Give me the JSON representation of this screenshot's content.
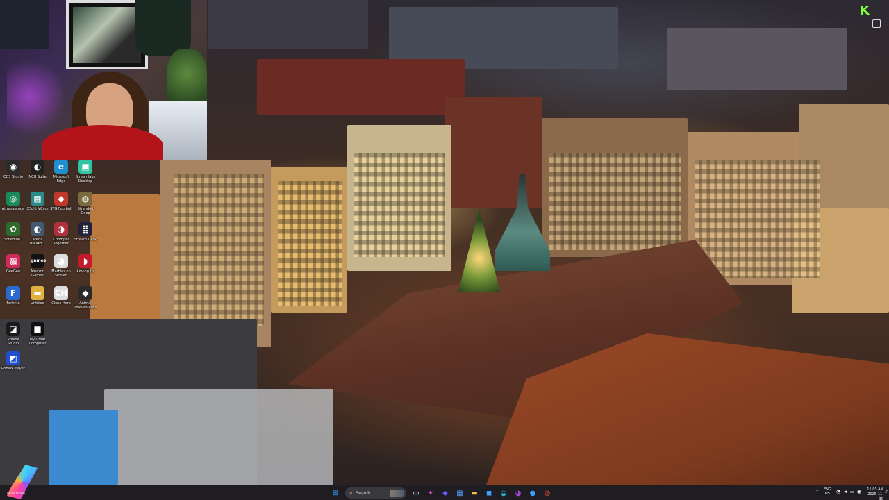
{
  "desktop": {
    "icons": [
      {
        "id": "obs",
        "label": "OBS Studio",
        "color": "#2b2b2b",
        "glyph": "◉"
      },
      {
        "id": "nch",
        "label": "NCH Suite",
        "color": "#222222",
        "glyph": "◐"
      },
      {
        "id": "edge",
        "label": "Microsoft Edge",
        "color": "#1f8fd0",
        "glyph": "e"
      },
      {
        "id": "streamlabs",
        "label": "Streamlabs Desktop",
        "color": "#31c3a2",
        "glyph": "▣"
      },
      {
        "id": "athenascope",
        "label": "Athenascope",
        "color": "#1a8a5a",
        "glyph": "◎"
      },
      {
        "id": "xsplit",
        "label": "XSplit VCam",
        "color": "#2a8a8a",
        "glyph": "▦"
      },
      {
        "id": "stgfootball",
        "label": "STG Football",
        "color": "#c0392b",
        "glyph": "◆"
      },
      {
        "id": "stranded",
        "label": "Stranded Deep",
        "color": "#7a6a40",
        "glyph": "◍"
      },
      {
        "id": "schedule",
        "label": "Schedule I",
        "color": "#2d6a2d",
        "glyph": "✿"
      },
      {
        "id": "arena",
        "label": "Arena Breako...",
        "color": "#445a70",
        "glyph": "◐"
      },
      {
        "id": "chomper",
        "label": "Chomper Together",
        "color": "#b03040",
        "glyph": "◑"
      },
      {
        "id": "streamdeck",
        "label": "Stream Deck",
        "color": "#22223a",
        "glyph": "⣿"
      },
      {
        "id": "geegee",
        "label": "GeeGee",
        "color": "#d02a5a",
        "glyph": "▩"
      },
      {
        "id": "games",
        "label": "Amazon Games",
        "color": "#111111",
        "glyph": "games"
      },
      {
        "id": "marbles",
        "label": "Marbles on Stream",
        "color": "#dddddd",
        "glyph": "◕"
      },
      {
        "id": "among",
        "label": "Among Us",
        "color": "#c21b2b",
        "glyph": "◗"
      },
      {
        "id": "fortnite",
        "label": "Fortnite",
        "color": "#2a6ad0",
        "glyph": "F"
      },
      {
        "id": "untitled",
        "label": "Untitled",
        "color": "#e0b040",
        "glyph": "▬"
      },
      {
        "id": "clone",
        "label": "Clone Hero",
        "color": "#dddddd",
        "glyph": "CH"
      },
      {
        "id": "thieves",
        "label": "Animal Thieves Rush",
        "color": "#2a2a2a",
        "glyph": "◆"
      },
      {
        "id": "robloxstudio",
        "label": "Roblox Studio",
        "color": "#1b1b1b",
        "glyph": "◪"
      },
      {
        "id": "mygreat",
        "label": "My Great Computer",
        "color": "#101010",
        "glyph": "■"
      },
      {
        "id": "robloxplayer",
        "label": "Roblox Player",
        "color": "#2050d0",
        "glyph": "◩"
      }
    ]
  },
  "corner_logo": {
    "text": "K"
  },
  "taskbar": {
    "weather": "New Moon",
    "search_placeholder": "Search",
    "apps": [
      {
        "id": "start",
        "glyph": "⊞",
        "color": "#3aa0ff"
      },
      {
        "id": "taskview",
        "glyph": "▭",
        "color": "#ffffff"
      },
      {
        "id": "copilot",
        "glyph": "✦",
        "color": "#e04ad0"
      },
      {
        "id": "teams",
        "glyph": "◆",
        "color": "#6a5cff"
      },
      {
        "id": "widgets",
        "glyph": "▦",
        "color": "#5aa0ff"
      },
      {
        "id": "explorer",
        "glyph": "▬",
        "color": "#f5c242"
      },
      {
        "id": "store",
        "glyph": "◼",
        "color": "#3aa0ff"
      },
      {
        "id": "edge",
        "glyph": "◒",
        "color": "#2bb0d0"
      },
      {
        "id": "onenote",
        "glyph": "◕",
        "color": "#a04ad0"
      },
      {
        "id": "spotify",
        "glyph": "●",
        "color": "#3aa0ff"
      },
      {
        "id": "chrome",
        "glyph": "◍",
        "color": "#e04a3a"
      }
    ],
    "lang_top": "ENG",
    "lang_bottom": "US",
    "time": "11:03 AM",
    "date": "2025-11-30"
  }
}
